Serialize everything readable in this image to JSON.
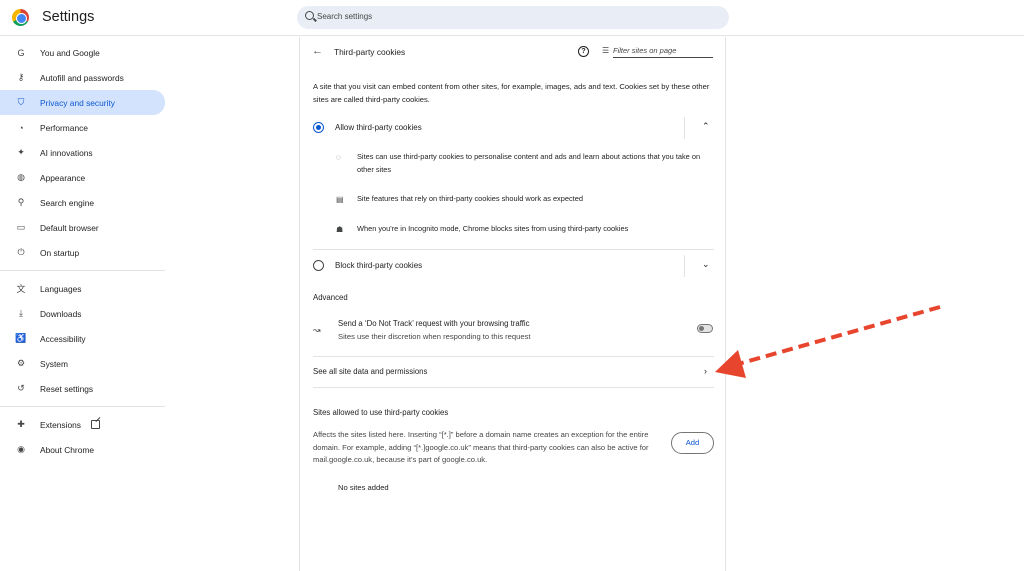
{
  "header": {
    "title": "Settings",
    "search_placeholder": "Search settings"
  },
  "sidebar": {
    "items": [
      {
        "label": "You and Google",
        "icon": "google-g-icon",
        "glyph": "G"
      },
      {
        "label": "Autofill and passwords",
        "icon": "key-icon",
        "glyph": "⚷"
      },
      {
        "label": "Privacy and security",
        "icon": "shield-icon",
        "glyph": "⛉",
        "active": true
      },
      {
        "label": "Performance",
        "icon": "speedometer-icon",
        "glyph": "◔"
      },
      {
        "label": "AI innovations",
        "icon": "sparkle-icon",
        "glyph": "✦"
      },
      {
        "label": "Appearance",
        "icon": "palette-icon",
        "glyph": "◍"
      },
      {
        "label": "Search engine",
        "icon": "search-icon",
        "glyph": "⚲"
      },
      {
        "label": "Default browser",
        "icon": "browser-icon",
        "glyph": "▭"
      },
      {
        "label": "On startup",
        "icon": "power-icon",
        "glyph": "⏻"
      }
    ],
    "items2": [
      {
        "label": "Languages",
        "icon": "translate-icon",
        "glyph": "文"
      },
      {
        "label": "Downloads",
        "icon": "download-icon",
        "glyph": "⤓"
      },
      {
        "label": "Accessibility",
        "icon": "accessibility-icon",
        "glyph": "♿"
      },
      {
        "label": "System",
        "icon": "wrench-icon",
        "glyph": "⚙"
      },
      {
        "label": "Reset settings",
        "icon": "reset-icon",
        "glyph": "↺"
      }
    ],
    "items3": [
      {
        "label": "Extensions",
        "icon": "puzzle-icon",
        "glyph": "✚"
      },
      {
        "label": "About Chrome",
        "icon": "chrome-icon",
        "glyph": "◉"
      }
    ]
  },
  "main": {
    "title": "Third-party cookies",
    "filter_placeholder": "Filter sites on page",
    "description": "A site that you visit can embed content from other sites, for example, images, ads and text. Cookies set by these other sites are called third-party cookies.",
    "allow_label": "Allow third-party cookies",
    "allow_details": [
      {
        "icon": "cookie-icon",
        "glyph": "◌",
        "text": "Sites can use third-party cookies to personalise content and ads and learn about actions that you take on other sites"
      },
      {
        "icon": "web-page-icon",
        "glyph": "▤",
        "text": "Site features that rely on third-party cookies should work as expected"
      },
      {
        "icon": "incognito-icon",
        "glyph": "☗",
        "text": "When you're in Incognito mode, Chrome blocks sites from using third-party cookies"
      }
    ],
    "block_label": "Block third-party cookies",
    "advanced_label": "Advanced",
    "dnt_title": "Send a ‘Do Not Track’ request with your browsing traffic",
    "dnt_subtitle": "Sites use their discretion when responding to this request",
    "see_all_label": "See all site data and permissions",
    "sites_title": "Sites allowed to use third-party cookies",
    "sites_description": "Affects the sites listed here. Inserting “[*.]” before a domain name creates an exception for the entire domain. For example, adding “[*.]google.co.uk” means that third-party cookies can also be active for mail.google.co.uk, because it’s part of google.co.uk.",
    "add_label": "Add",
    "no_sites_label": "No sites added"
  },
  "colors": {
    "accent": "#0b57d0",
    "active_bg": "#d3e3fd",
    "annotation_arrow": "#e8452e"
  }
}
